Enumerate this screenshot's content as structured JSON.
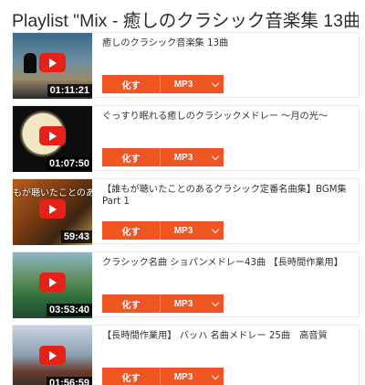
{
  "playlist": {
    "title": "Playlist \"Mix - 癒しのクラシック音楽集 13曲\""
  },
  "items": [
    {
      "title": "癒しのクラシック音楽集 13曲",
      "duration": "01:11:21",
      "convert_label": "化す",
      "format_label": "MP3",
      "overlay": ""
    },
    {
      "title": "ぐっすり眠れる癒しのクラシックメドレー ～月の光～",
      "duration": "01:07:50",
      "convert_label": "化す",
      "format_label": "MP3",
      "overlay": ""
    },
    {
      "title": "【誰もが聴いたことのあるクラシック定番名曲集】BGM集Part 1",
      "duration": "59:43",
      "convert_label": "化す",
      "format_label": "MP3",
      "overlay": "もが聴いたことのあ"
    },
    {
      "title": "クラシック名曲 ショパンメドレー43曲 【長時間作業用】",
      "duration": "03:53:40",
      "convert_label": "化す",
      "format_label": "MP3",
      "overlay": ""
    },
    {
      "title": "【長時間作業用】 バッハ 名曲メドレー 25曲　高音質",
      "duration": "01:56:59",
      "convert_label": "化す",
      "format_label": "MP3",
      "overlay": ""
    }
  ],
  "colors": {
    "accent": "#ef5623",
    "play_red": "#e62117"
  },
  "icons": {
    "play": "play-icon",
    "dropdown": "chevron-down-icon"
  }
}
